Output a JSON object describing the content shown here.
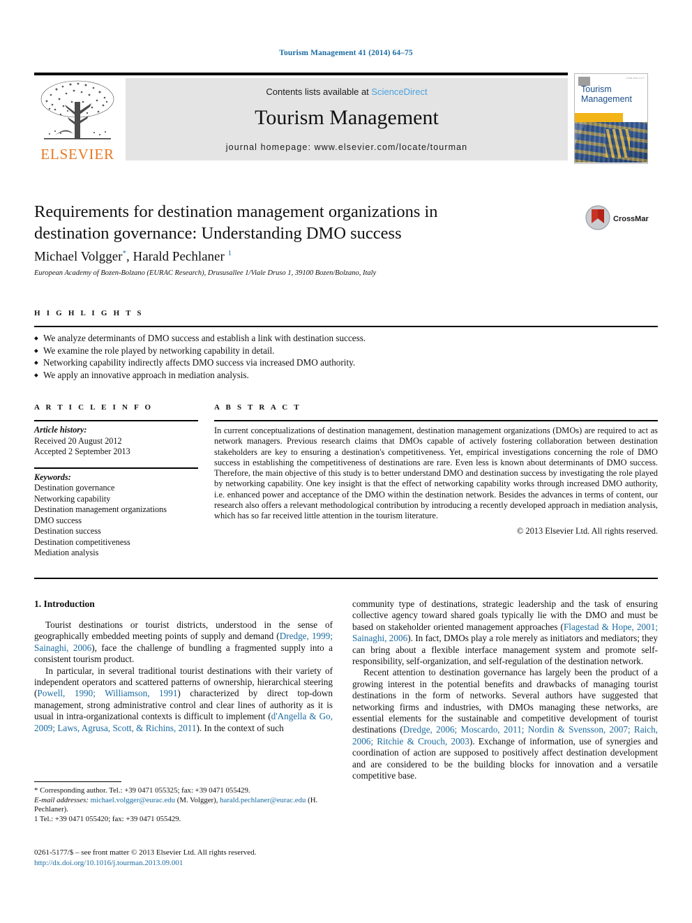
{
  "running_head": "Tourism Management 41 (2014) 64–75",
  "masthead": {
    "contents_prefix": "Contents lists available at ",
    "sciencedirect": "ScienceDirect",
    "journal_title": "Tourism Management",
    "homepage": "journal homepage: www.elsevier.com/locate/tourman",
    "publisher": "ELSEVIER",
    "cover_title_line1": "Tourism",
    "cover_title_line2": "Management",
    "cover_issn": "ISSN 0261-5177"
  },
  "crossmark": {
    "label": "CrossMark"
  },
  "article": {
    "title": "Requirements for destination management organizations in destination governance: Understanding DMO success",
    "author1": "Michael Volgger",
    "author1_mark": "*",
    "author2": "Harald Pechlaner",
    "author2_mark": "1",
    "affiliation": "European Academy of Bozen-Bolzano (EURAC Research), Drususallee 1/Viale Druso 1, 39100 Bozen/Bolzano, Italy"
  },
  "highlights": {
    "label": "H I G H L I G H T S",
    "items": [
      "We analyze determinants of DMO success and establish a link with destination success.",
      "We examine the role played by networking capability in detail.",
      "Networking capability indirectly affects DMO success via increased DMO authority.",
      "We apply an innovative approach in mediation analysis."
    ]
  },
  "article_info": {
    "label": "A R T I C L E   I N F O",
    "history_head": "Article history:",
    "received": "Received 20 August 2012",
    "accepted": "Accepted 2 September 2013",
    "keywords_head": "Keywords:",
    "keywords": [
      "Destination governance",
      "Networking capability",
      "Destination management organizations",
      "DMO success",
      "Destination success",
      "Destination competitiveness",
      "Mediation analysis"
    ]
  },
  "abstract": {
    "label": "A B S T R A C T",
    "text": "In current conceptualizations of destination management, destination management organizations (DMOs) are required to act as network managers. Previous research claims that DMOs capable of actively fostering collaboration between destination stakeholders are key to ensuring a destination's competitiveness. Yet, empirical investigations concerning the role of DMO success in establishing the competitiveness of destinations are rare. Even less is known about determinants of DMO success. Therefore, the main objective of this study is to better understand DMO and destination success by investigating the role played by networking capability. One key insight is that the effect of networking capability works through increased DMO authority, i.e. enhanced power and acceptance of the DMO within the destination network. Besides the advances in terms of content, our research also offers a relevant methodological contribution by introducing a recently developed approach in mediation analysis, which has so far received little attention in the tourism literature.",
    "copyright": "© 2013 Elsevier Ltd. All rights reserved."
  },
  "body": {
    "section_heading": "1. Introduction",
    "left_p1_a": "Tourist destinations or tourist districts, understood in the sense of geographically embedded meeting points of supply and demand (",
    "left_p1_cite": "Dredge, 1999; Sainaghi, 2006",
    "left_p1_b": "), face the challenge of bundling a fragmented supply into a consistent tourism product.",
    "left_p2_a": "In particular, in several traditional tourist destinations with their variety of independent operators and scattered patterns of ownership, hierarchical steering (",
    "left_p2_cite1": "Powell, 1990; Williamson, 1991",
    "left_p2_b": ") characterized by direct top-down management, strong administrative control and clear lines of authority as it is usual in intra-organizational contexts is difficult to implement (",
    "left_p2_cite2": "d'Angella & Go, 2009; Laws, Agrusa, Scott, & Richins, 2011",
    "left_p2_c": "). In the context of such",
    "right_p1_a": "community type of destinations, strategic leadership and the task of ensuring collective agency toward shared goals typically lie with the DMO and must be based on stakeholder oriented management approaches (",
    "right_p1_cite": "Flagestad & Hope, 2001; Sainaghi, 2006",
    "right_p1_b": "). In fact, DMOs play a role merely as initiators and mediators; they can bring about a flexible interface management system and promote self-responsibility, self-organization, and self-regulation of the destination network.",
    "right_p2_a": "Recent attention to destination governance has largely been the product of a growing interest in the potential benefits and drawbacks of managing tourist destinations in the form of networks. Several authors have suggested that networking firms and industries, with DMOs managing these networks, are essential elements for the sustainable and competitive development of tourist destinations (",
    "right_p2_cite": "Dredge, 2006; Moscardo, 2011; Nordin & Svensson, 2007; Raich, 2006; Ritchie & Crouch, 2003",
    "right_p2_b": "). Exchange of information, use of synergies and coordination of action are supposed to positively affect destination development and are considered to be the building blocks for innovation and a versatile competitive base."
  },
  "footnotes": {
    "corresponding": "* Corresponding author. Tel.: +39 0471 055325; fax: +39 0471 055429.",
    "email_label": "E-mail addresses:",
    "email1": "michael.volgger@eurac.edu",
    "email1_owner": "(M. Volgger),",
    "email2": "harald.pechlaner@eurac.edu",
    "email2_owner": "(H. Pechlaner).",
    "note1": "1 Tel.: +39 0471 055420; fax: +39 0471 055429.",
    "frontmatter": "0261-5177/$ – see front matter © 2013 Elsevier Ltd. All rights reserved.",
    "doi": "http://dx.doi.org/10.1016/j.tourman.2013.09.001"
  }
}
